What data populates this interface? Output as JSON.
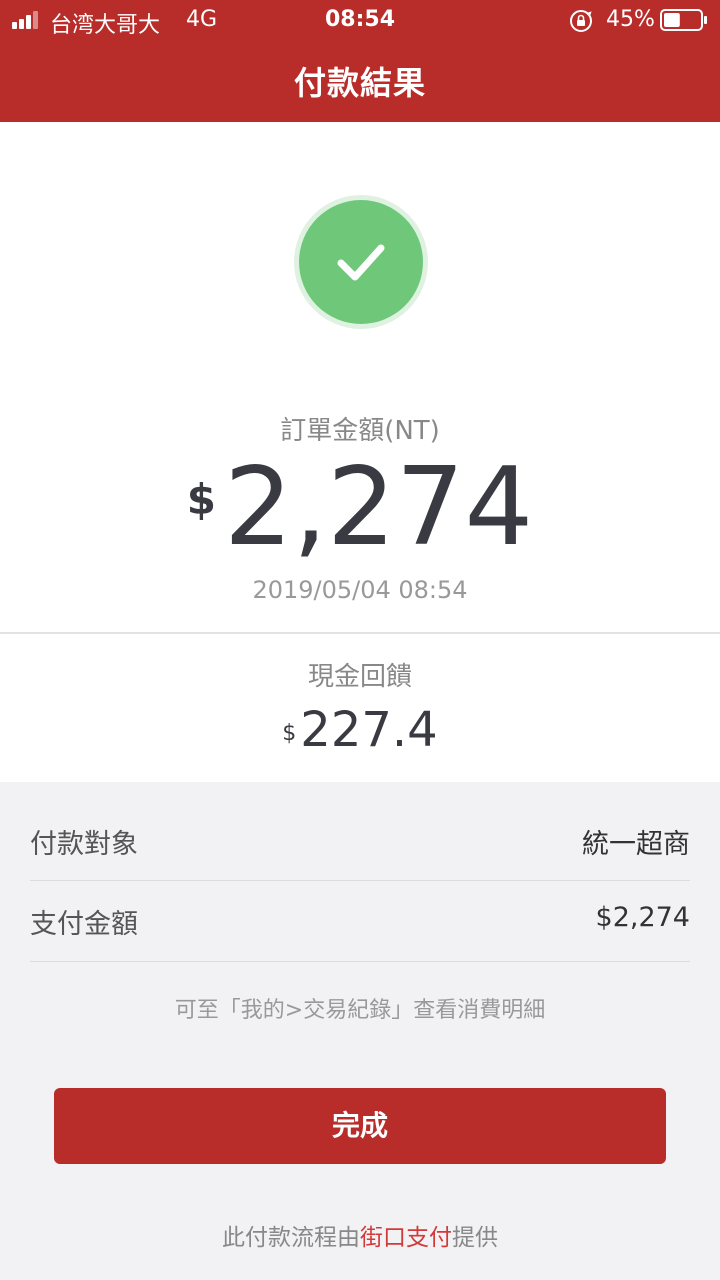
{
  "status_bar": {
    "carrier": "台湾大哥大",
    "network": "4G",
    "time": "08:54",
    "battery": "45%",
    "battery_level": 0.45
  },
  "header": {
    "title": "付款結果"
  },
  "result": {
    "order_amount_label": "訂單金額(NT)",
    "currency_symbol": "$",
    "order_amount": "2,274",
    "datetime": "2019/05/04 08:54",
    "cashback_label": "現金回饋",
    "cashback_currency": "$",
    "cashback_amount": "227.4"
  },
  "details": [
    {
      "key": "付款對象",
      "value": "統一超商"
    },
    {
      "key": "支付金額",
      "value": "$2,274"
    }
  ],
  "hint": "可至「我的>交易紀錄」查看消費明細",
  "done_label": "完成",
  "footer": {
    "prefix": "此付款流程由",
    "brand": "街口支付",
    "suffix": "提供"
  },
  "colors": {
    "brand_red": "#b82c2a",
    "success_green": "#6fc87a"
  }
}
